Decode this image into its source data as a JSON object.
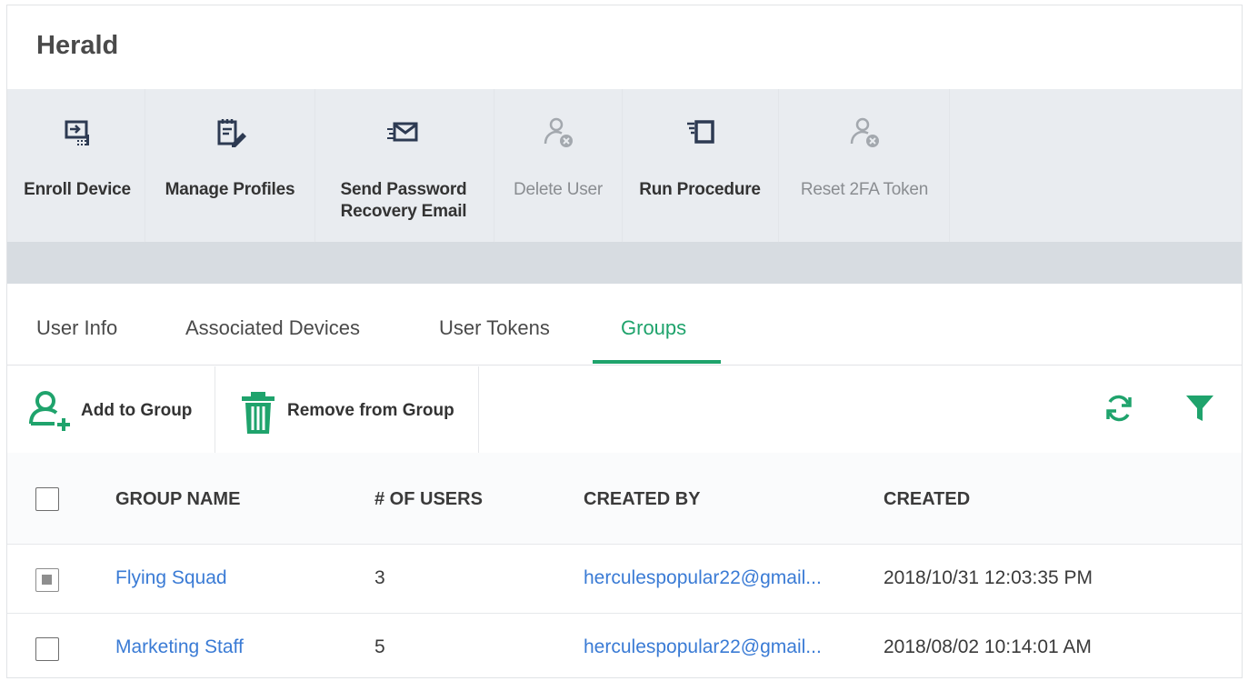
{
  "header": {
    "title": "Herald"
  },
  "toolbar": {
    "items": [
      {
        "label": "Enroll Device",
        "icon": "enroll-device-icon",
        "enabled": true
      },
      {
        "label": "Manage Profiles",
        "icon": "manage-profiles-icon",
        "enabled": true
      },
      {
        "label": "Send Password Recovery Email",
        "label_line1": "Send Password",
        "label_line2": "Recovery Email",
        "icon": "envelope-icon",
        "enabled": true
      },
      {
        "label": "Delete User",
        "icon": "user-remove-icon",
        "enabled": false
      },
      {
        "label": "Run Procedure",
        "icon": "run-procedure-icon",
        "enabled": true
      },
      {
        "label": "Reset 2FA Token",
        "icon": "user-remove-icon",
        "enabled": false
      }
    ]
  },
  "tabs": [
    {
      "label": "User Info",
      "active": false
    },
    {
      "label": "Associated Devices",
      "active": false
    },
    {
      "label": "User Tokens",
      "active": false
    },
    {
      "label": "Groups",
      "active": true
    }
  ],
  "actions": {
    "add_to_group": "Add to Group",
    "remove_from_group": "Remove from Group"
  },
  "table": {
    "headers": [
      "GROUP NAME",
      "# OF USERS",
      "CREATED BY",
      "CREATED"
    ],
    "rows": [
      {
        "group_name": "Flying Squad",
        "users": "3",
        "created_by": "herculespopular22@gmail...",
        "created": "2018/10/31 12:03:35 PM",
        "checked": true
      },
      {
        "group_name": "Marketing Staff",
        "users": "5",
        "created_by": "herculespopular22@gmail...",
        "created": "2018/08/02 10:14:01 AM",
        "checked": false
      }
    ]
  },
  "colors": {
    "accent": "#1fa36c",
    "link": "#3a7bd5",
    "toolbar_bg": "#e9ecf0",
    "band_bg": "#d7dce1"
  }
}
